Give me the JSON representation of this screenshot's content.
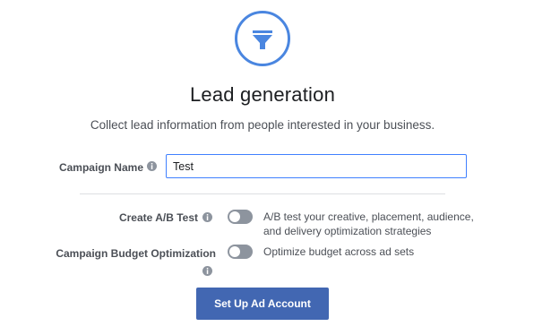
{
  "header": {
    "icon": "funnel-icon",
    "title": "Lead generation",
    "subtitle": "Collect lead information from people interested in your business."
  },
  "campaign_name": {
    "label": "Campaign Name",
    "info_icon": "info-icon",
    "value": "Test"
  },
  "ab_test": {
    "label": "Create A/B Test",
    "info_icon": "info-icon",
    "enabled": false,
    "description_line1": "A/B test your creative, placement, audience,",
    "description_line2": "and delivery optimization strategies"
  },
  "budget_optimization": {
    "label": "Campaign Budget Optimization",
    "info_icon": "info-icon",
    "enabled": false,
    "description": "Optimize budget across ad sets"
  },
  "actions": {
    "setup_button": "Set Up Ad Account"
  },
  "colors": {
    "accent": "#4a86e0",
    "button": "#4267b2",
    "toggle_off": "#8d949e",
    "input_focus_border": "#4080ff"
  }
}
